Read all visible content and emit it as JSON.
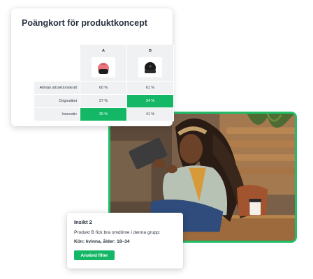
{
  "scorecard": {
    "title": "Poängkort för produktkoncept",
    "columns": [
      {
        "label": "A",
        "product_color": "#e8747c"
      },
      {
        "label": "B",
        "product_color": "#1b1b1b"
      }
    ],
    "rows": [
      {
        "label": "Allmän attraktionskraft",
        "a": "60 %",
        "b": "61 %",
        "highlight": "none"
      },
      {
        "label": "Originalitet",
        "a": "27 %",
        "b": "34 %",
        "highlight": "b"
      },
      {
        "label": "Innovativ",
        "a": "35 %",
        "b": "41 %",
        "highlight": "a"
      }
    ],
    "highlight_color": "#14b765"
  },
  "photo": {
    "border_color": "#1fbf6a",
    "subject": "woman-using-tablet-photo"
  },
  "insight": {
    "title": "Insikt 2",
    "text": "Produkt B fick bra omdöme i denna grupp:",
    "meta": "Kön: kvinna, ålder: 18–34",
    "button_label": "Använd filter"
  }
}
